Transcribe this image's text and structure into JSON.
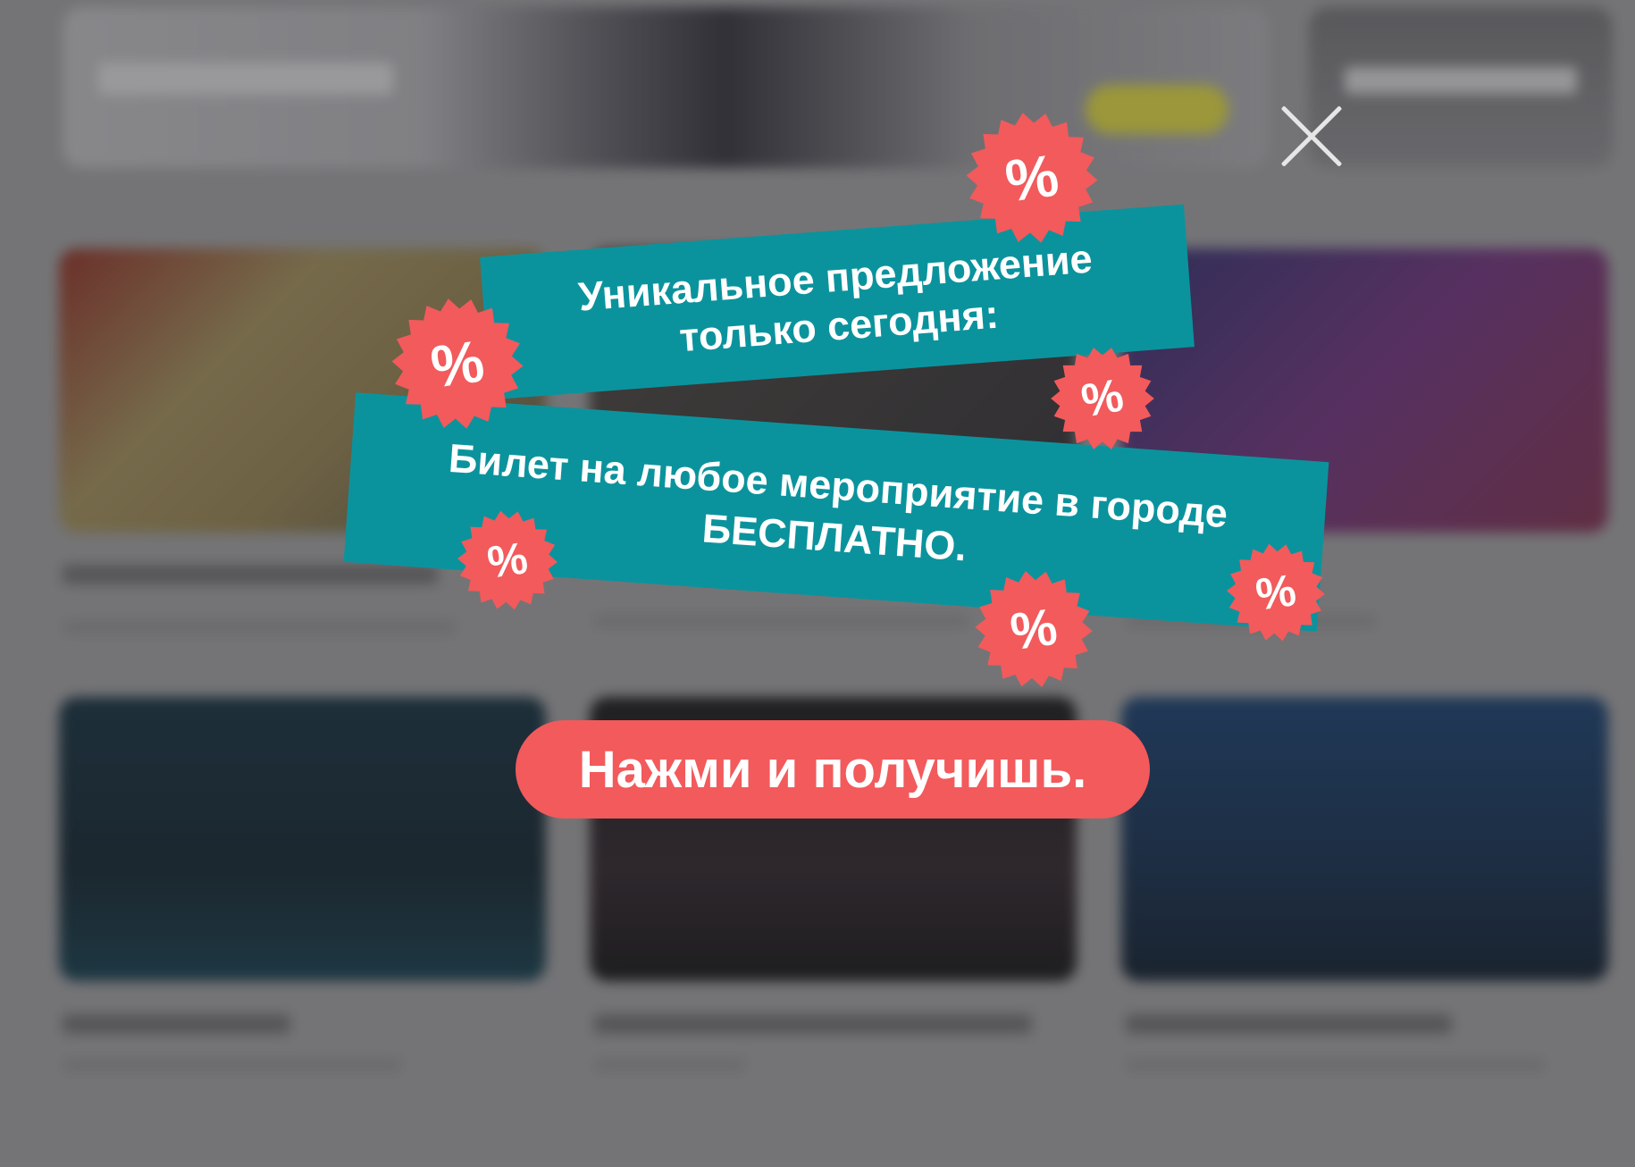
{
  "offer": {
    "headline_line1": "Уникальное предложение",
    "headline_line2": "только сегодня:",
    "body_line1": "Билет на любое мероприятие в городе",
    "body_line2": "БЕСПЛАТНО.",
    "badge_symbol": "%",
    "cta_label": "Нажми и получишь."
  },
  "colors": {
    "ribbon": "#0b939d",
    "badge": "#f25a5c",
    "cta": "#f25a5c",
    "close_icon": "#e6e6e6"
  },
  "icons": {
    "close": "close-icon",
    "badge": "percent-badge-icon"
  }
}
